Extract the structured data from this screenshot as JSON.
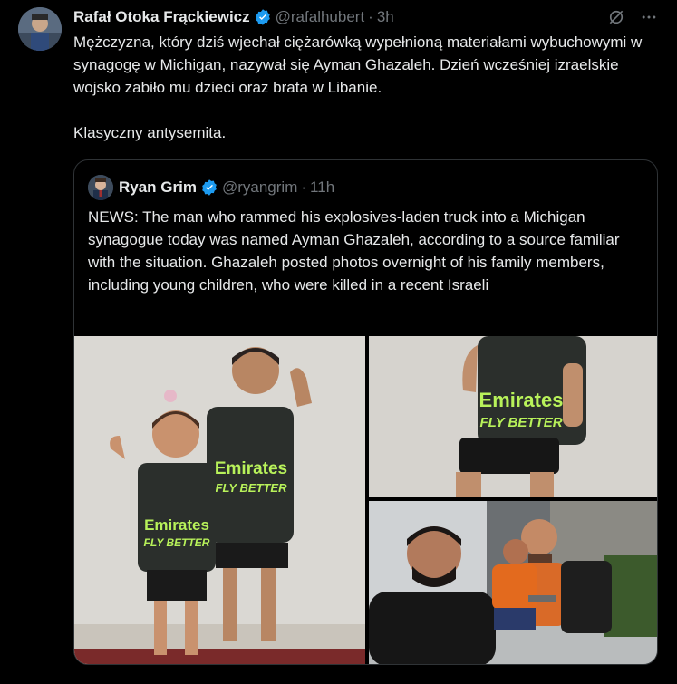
{
  "author": {
    "name": "Rafał Otoka Frąckiewicz",
    "handle": "@rafalhubert",
    "separator": "·",
    "time": "3h"
  },
  "tweet": {
    "paragraph1": "Mężczyzna, który dziś wjechał ciężarówką wypełnioną materiałami wybuchowymi w synagogę w Michigan, nazywał się Ayman Ghazaleh. Dzień wcześniej izraelskie wojsko zabiło mu dzieci oraz brata w Libanie.",
    "paragraph2": "Klasyczny antysemita."
  },
  "quoted": {
    "name": "Ryan Grim",
    "handle": "@ryangrim",
    "separator": "·",
    "time": "11h",
    "text": "NEWS: The man who rammed his explosives-laden truck into a Michigan synagogue today was named Ayman Ghazaleh, according to a source familiar with the situation. Ghazaleh posted photos overnight of his family members, including young children, who were killed in a recent Israeli"
  },
  "jersey_text": {
    "line1": "Emirates",
    "line2": "FLY BETTER"
  },
  "colors": {
    "background": "#000000",
    "text": "#e7e9ea",
    "muted": "#71767b",
    "verified": "#1d9bf0",
    "border": "#2f3336",
    "jersey": "#2b2f2c",
    "jersey_text": "#b8f25a"
  },
  "icons": {
    "verified": "verified-badge-icon",
    "grok": "grok-icon",
    "more": "more-icon"
  }
}
